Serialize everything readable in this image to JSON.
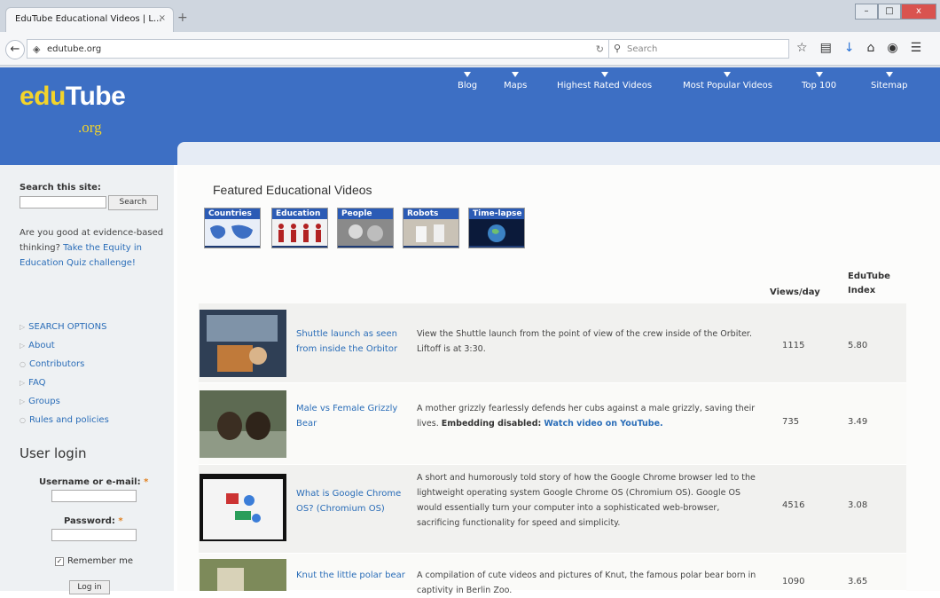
{
  "browser": {
    "tab_title": "EduTube Educational Videos | L...",
    "tab_close": "×",
    "new_tab": "+",
    "url": "edutube.org",
    "search_placeholder": "Search",
    "window_min": "–",
    "window_max": "□",
    "window_close": "x"
  },
  "header": {
    "logo_edu": "edu",
    "logo_tube": "Tube",
    "logo_org": ".org",
    "nav": [
      "Blog",
      "Maps",
      "Highest Rated Videos",
      "Most Popular Videos",
      "Top 100",
      "Sitemap"
    ]
  },
  "sidebar": {
    "search_title": "Search this site:",
    "search_button": "Search",
    "quiz_text": "Are you good at evidence-based thinking?",
    "quiz_link": "Take the Equity in Education Quiz challenge!",
    "links": [
      "SEARCH OPTIONS",
      "About",
      "Contributors",
      "FAQ",
      "Groups",
      "Rules and policies"
    ],
    "login_title": "User login",
    "username_label": "Username or e-mail:",
    "password_label": "Password:",
    "required_mark": "*",
    "remember_label": "Remember me",
    "remember_checked": true,
    "login_button": "Log in"
  },
  "main": {
    "title": "Featured Educational Videos",
    "categories": [
      "Countries",
      "Education",
      "People",
      "Robots",
      "Time-lapse"
    ],
    "col_views": "Views/day",
    "col_index": "EduTube Index",
    "videos": [
      {
        "title": "Shuttle launch as seen from inside the Orbitor",
        "desc": "View the Shuttle launch from the point of view of the crew inside of the Orbiter. Liftoff is at 3:30.",
        "desc_bold": "",
        "desc_link": "",
        "views": "1115",
        "index": "5.80"
      },
      {
        "title": "Male vs Female Grizzly Bear",
        "desc": "A mother grizzly fearlessly defends her cubs against a male grizzly, saving their lives.",
        "desc_bold": "Embedding disabled:",
        "desc_link": "Watch video on YouTube.",
        "views": "735",
        "index": "3.49"
      },
      {
        "title": "What is Google Chrome OS? (Chromium OS)",
        "desc": "A short and humorously told story of how the Google Chrome browser led to the lightweight operating system Google Chrome OS (Chromium OS). Google OS would essentially turn your computer into a sophisticated web-browser, sacrificing functionality for speed and simplicity.",
        "desc_bold": "",
        "desc_link": "",
        "views": "4516",
        "index": "3.08"
      },
      {
        "title": "Knut the little polar bear",
        "desc": "A compilation of cute videos and pictures of Knut, the famous polar bear born in captivity in Berlin Zoo.",
        "desc_bold": "",
        "desc_link": "",
        "views": "1090",
        "index": "3.65"
      }
    ]
  }
}
